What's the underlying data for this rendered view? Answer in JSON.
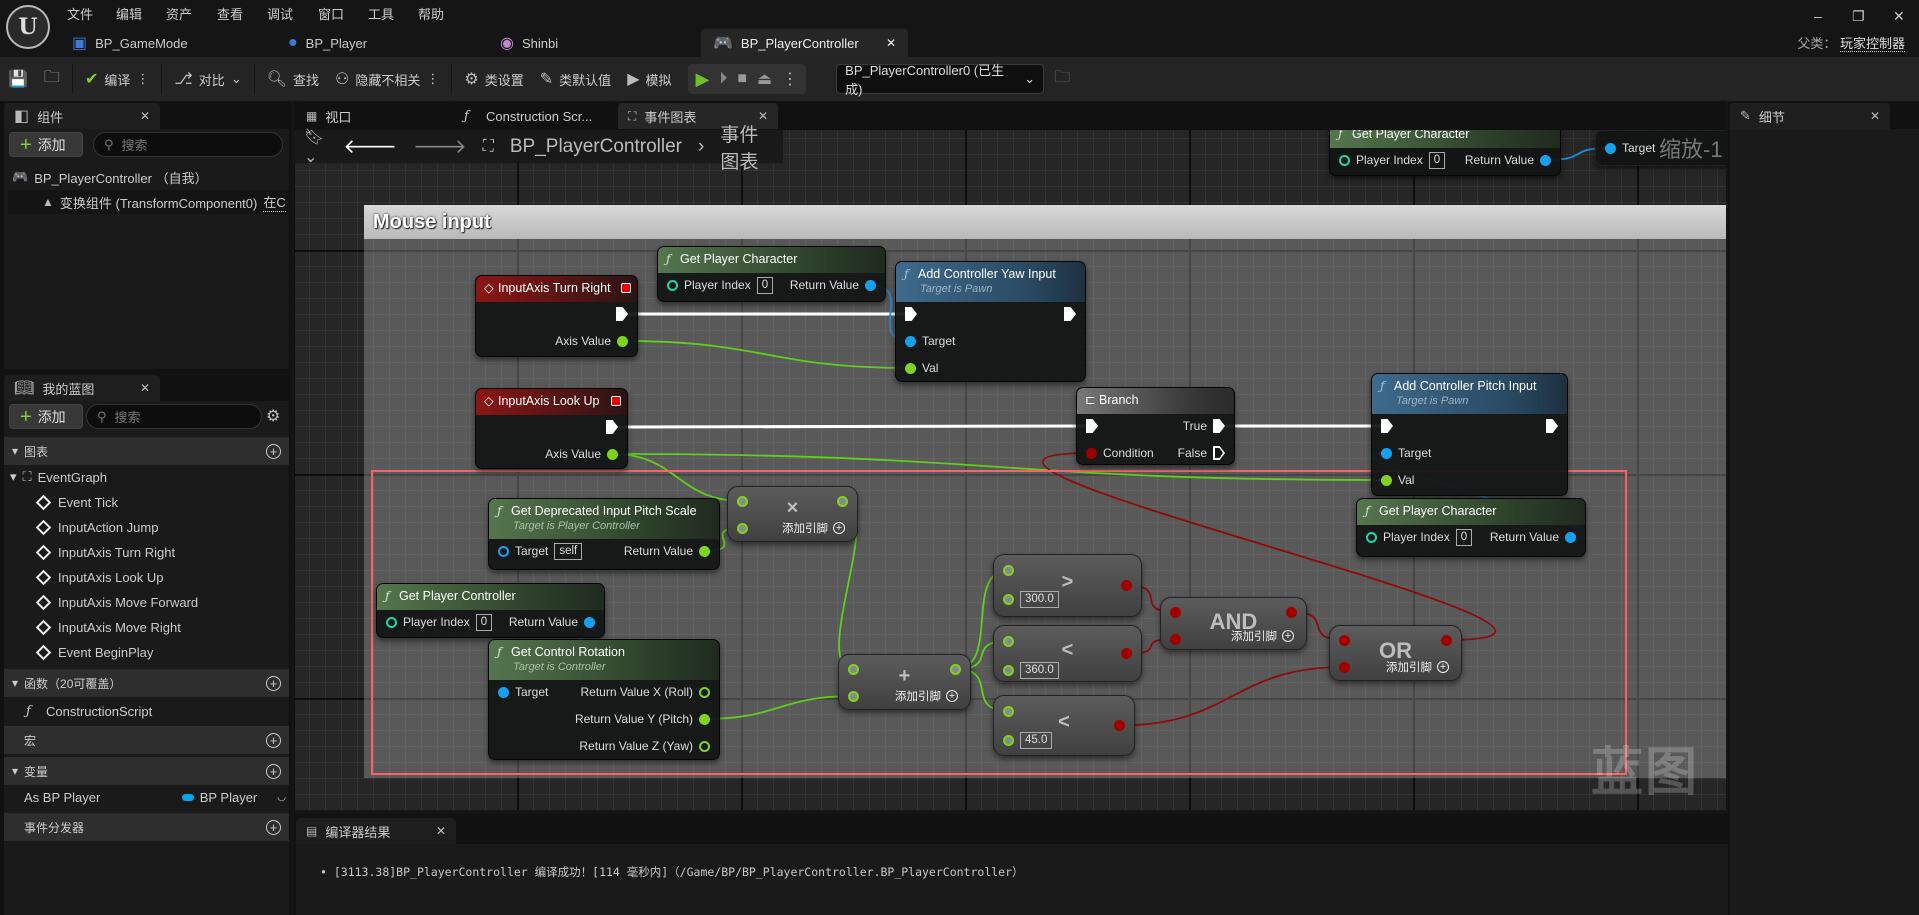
{
  "menu": [
    "文件",
    "编辑",
    "资产",
    "查看",
    "调试",
    "窗口",
    "工具",
    "帮助"
  ],
  "doc_tabs": [
    {
      "label": "BP_GameMode",
      "icon": "gamemode-icon"
    },
    {
      "label": "BP_Player",
      "icon": "pawn-icon"
    },
    {
      "label": "Shinbi",
      "icon": "skeleton-icon"
    },
    {
      "label": "BP_PlayerController",
      "icon": "gamepad-icon",
      "active": true
    }
  ],
  "parent_class": {
    "label": "父类：",
    "value": "玩家控制器"
  },
  "toolbar": {
    "compile": "编译",
    "diff": "对比",
    "find": "查找",
    "hide_unrelated": "隐藏不相关",
    "class_settings": "类设置",
    "class_defaults": "类默认值",
    "simulate": "模拟",
    "debug_object": "BP_PlayerController0 (已生成)"
  },
  "components": {
    "tab": "组件",
    "add": "添加",
    "search_placeholder": "搜索",
    "root": "BP_PlayerController （自我）",
    "child": "变换组件 (TransformComponent0)",
    "child_suffix": "在C"
  },
  "my_blueprint": {
    "tab": "我的蓝图",
    "add": "添加",
    "search_placeholder": "搜索",
    "graphs_header": "图表",
    "event_graph": "EventGraph",
    "events": [
      "Event Tick",
      "InputAction Jump",
      "InputAxis Turn Right",
      "InputAxis Look Up",
      "InputAxis Move Forward",
      "InputAxis Move Right",
      "Event BeginPlay"
    ],
    "functions_header": "函数（20可覆盖）",
    "functions": [
      "ConstructionScript"
    ],
    "macros_header": "宏",
    "variables_header": "变量",
    "variables": [
      {
        "name": "As BP Player",
        "type": "BP Player",
        "type_color": "#00a8f3"
      }
    ],
    "dispatchers_header": "事件分发器"
  },
  "graph_tabs": [
    {
      "label": "视口"
    },
    {
      "label": "Construction Scr..."
    },
    {
      "label": "事件图表",
      "active": true
    }
  ],
  "details": {
    "tab": "细节"
  },
  "breadcrumb": {
    "root": "BP_PlayerController",
    "current": "事件图表"
  },
  "graph": {
    "comment": "Mouse input",
    "zoom_label": "缩放-1",
    "watermark": "蓝图",
    "colors": {
      "exec": "#ffffff",
      "float": "#7ed321",
      "object": "#16a0f0",
      "bool": "#a00000",
      "int": "#1fd6a6",
      "selection": "#ff5f66"
    },
    "nodes": [
      {
        "id": "turn_right",
        "kind": "event",
        "title": "InputAxis Turn Right",
        "inputs": [],
        "outputs": [
          {
            "id": "exec",
            "type": "exec"
          },
          {
            "id": "axis",
            "label": "Axis Value",
            "type": "float"
          }
        ]
      },
      {
        "id": "gpc1",
        "kind": "pure",
        "title": "Get Player Character",
        "inputs": [
          {
            "id": "idx",
            "label": "Player Index",
            "type": "int",
            "default": "0"
          }
        ],
        "outputs": [
          {
            "id": "rv",
            "label": "Return Value",
            "type": "object"
          }
        ]
      },
      {
        "id": "yaw",
        "kind": "call",
        "title": "Add Controller Yaw Input",
        "subtitle": "Target is Pawn",
        "inputs": [
          {
            "id": "exec",
            "type": "exec"
          },
          {
            "id": "target",
            "label": "Target",
            "type": "object"
          },
          {
            "id": "val",
            "label": "Val",
            "type": "float"
          }
        ],
        "outputs": [
          {
            "id": "exec",
            "type": "exec"
          }
        ]
      },
      {
        "id": "look_up",
        "kind": "event",
        "title": "InputAxis Look Up",
        "inputs": [],
        "outputs": [
          {
            "id": "exec",
            "type": "exec"
          },
          {
            "id": "axis",
            "label": "Axis Value",
            "type": "float"
          }
        ]
      },
      {
        "id": "branch",
        "kind": "branch",
        "title": "Branch",
        "inputs": [
          {
            "id": "exec",
            "type": "exec"
          },
          {
            "id": "cond",
            "label": "Condition",
            "type": "bool"
          }
        ],
        "outputs": [
          {
            "id": "true",
            "label": "True",
            "type": "exec"
          },
          {
            "id": "false",
            "label": "False",
            "type": "exec"
          }
        ]
      },
      {
        "id": "pitch",
        "kind": "call",
        "title": "Add Controller Pitch Input",
        "subtitle": "Target is Pawn",
        "inputs": [
          {
            "id": "exec",
            "type": "exec"
          },
          {
            "id": "target",
            "label": "Target",
            "type": "object"
          },
          {
            "id": "val",
            "label": "Val",
            "type": "float"
          }
        ],
        "outputs": [
          {
            "id": "exec",
            "type": "exec"
          }
        ]
      },
      {
        "id": "gpc2",
        "kind": "pure",
        "title": "Get Player Character",
        "inputs": [
          {
            "id": "idx",
            "label": "Player Index",
            "type": "int",
            "default": "0"
          }
        ],
        "outputs": [
          {
            "id": "rv",
            "label": "Return Value",
            "type": "object"
          }
        ]
      },
      {
        "id": "pitch_scale",
        "kind": "pure",
        "title": "Get Deprecated Input Pitch Scale",
        "subtitle": "Target is Player Controller",
        "inputs": [
          {
            "id": "target",
            "label": "Target",
            "type": "object",
            "default": "self"
          }
        ],
        "outputs": [
          {
            "id": "rv",
            "label": "Return Value",
            "type": "float"
          }
        ]
      },
      {
        "id": "mul",
        "kind": "math",
        "symbol": "×",
        "add_pin": "添加引脚",
        "inputs": [
          {
            "id": "a",
            "type": "float"
          },
          {
            "id": "b",
            "type": "float"
          }
        ],
        "outputs": [
          {
            "id": "rv",
            "type": "float"
          }
        ]
      },
      {
        "id": "gpctrl",
        "kind": "pure",
        "title": "Get Player Controller",
        "inputs": [
          {
            "id": "idx",
            "label": "Player Index",
            "type": "int",
            "default": "0"
          }
        ],
        "outputs": [
          {
            "id": "rv",
            "label": "Return Value",
            "type": "object"
          }
        ]
      },
      {
        "id": "rot",
        "kind": "pure",
        "title": "Get Control Rotation",
        "subtitle": "Target is Controller",
        "inputs": [
          {
            "id": "target",
            "label": "Target",
            "type": "object"
          }
        ],
        "outputs": [
          {
            "id": "x",
            "label": "Return Value X (Roll)",
            "type": "float"
          },
          {
            "id": "y",
            "label": "Return Value Y (Pitch)",
            "type": "float"
          },
          {
            "id": "z",
            "label": "Return Value Z (Yaw)",
            "type": "float"
          }
        ]
      },
      {
        "id": "add",
        "kind": "math",
        "symbol": "+",
        "add_pin": "添加引脚",
        "inputs": [
          {
            "id": "a",
            "type": "float"
          },
          {
            "id": "b",
            "type": "float"
          }
        ],
        "outputs": [
          {
            "id": "rv",
            "type": "float"
          }
        ]
      },
      {
        "id": "gt",
        "kind": "compare",
        "symbol": ">",
        "inputs": [
          {
            "id": "a",
            "type": "float"
          },
          {
            "id": "b",
            "type": "float",
            "default": "300.0"
          }
        ],
        "outputs": [
          {
            "id": "rv",
            "type": "bool"
          }
        ]
      },
      {
        "id": "lt1",
        "kind": "compare",
        "symbol": "<",
        "inputs": [
          {
            "id": "a",
            "type": "float"
          },
          {
            "id": "b",
            "type": "float",
            "default": "360.0"
          }
        ],
        "outputs": [
          {
            "id": "rv",
            "type": "bool"
          }
        ]
      },
      {
        "id": "lt2",
        "kind": "compare",
        "symbol": "<",
        "inputs": [
          {
            "id": "a",
            "type": "float"
          },
          {
            "id": "b",
            "type": "float",
            "default": "45.0"
          }
        ],
        "outputs": [
          {
            "id": "rv",
            "type": "bool"
          }
        ]
      },
      {
        "id": "and",
        "kind": "math",
        "symbol": "AND",
        "add_pin": "添加引脚",
        "inputs": [
          {
            "id": "a",
            "type": "bool"
          },
          {
            "id": "b",
            "type": "bool"
          }
        ],
        "outputs": [
          {
            "id": "rv",
            "type": "bool"
          }
        ]
      },
      {
        "id": "or",
        "kind": "math",
        "symbol": "OR",
        "add_pin": "添加引脚",
        "inputs": [
          {
            "id": "a",
            "type": "bool"
          },
          {
            "id": "b",
            "type": "bool"
          }
        ],
        "outputs": [
          {
            "id": "rv",
            "type": "bool"
          }
        ]
      },
      {
        "id": "gpc_top",
        "kind": "pure",
        "title": "Get Player Character",
        "inputs": [
          {
            "id": "idx",
            "label": "Player Index",
            "type": "int",
            "default": "0"
          }
        ],
        "outputs": [
          {
            "id": "rv",
            "label": "Return Value",
            "type": "object"
          }
        ]
      },
      {
        "id": "target_partial",
        "kind": "partial",
        "inputs": [
          {
            "id": "target",
            "label": "Target",
            "type": "object"
          }
        ],
        "outputs": []
      }
    ],
    "links": [
      {
        "from": "turn_right.exec",
        "to": "yaw.exec",
        "type": "exec"
      },
      {
        "from": "look_up.exec",
        "to": "branch.exec",
        "type": "exec"
      },
      {
        "from": "branch.true",
        "to": "pitch.exec",
        "type": "exec"
      },
      {
        "from": "turn_right.axis",
        "to": "yaw.val",
        "type": "float"
      },
      {
        "from": "look_up.axis",
        "to": "pitch.val",
        "type": "float"
      },
      {
        "from": "look_up.axis",
        "to": "mul.a",
        "type": "float"
      },
      {
        "from": "pitch_scale.rv",
        "to": "mul.b",
        "type": "float"
      },
      {
        "from": "mul.rv",
        "to": "add.a",
        "type": "float"
      },
      {
        "from": "rot.y",
        "to": "add.b",
        "type": "float"
      },
      {
        "from": "add.rv",
        "to": "gt.a",
        "type": "float"
      },
      {
        "from": "add.rv",
        "to": "lt1.a",
        "type": "float"
      },
      {
        "from": "add.rv",
        "to": "lt2.a",
        "type": "float"
      },
      {
        "from": "gpc1.rv",
        "to": "yaw.target",
        "type": "object"
      },
      {
        "from": "gpc2.rv",
        "to": "pitch.target",
        "type": "object"
      },
      {
        "from": "gpctrl.rv",
        "to": "rot.target",
        "type": "object"
      },
      {
        "from": "gpc_top.rv",
        "to": "target_partial.target",
        "type": "object"
      },
      {
        "from": "gt.rv",
        "to": "and.a",
        "type": "bool"
      },
      {
        "from": "lt1.rv",
        "to": "and.b",
        "type": "bool"
      },
      {
        "from": "and.rv",
        "to": "or.a",
        "type": "bool"
      },
      {
        "from": "lt2.rv",
        "to": "or.b",
        "type": "bool"
      },
      {
        "from": "or.rv",
        "to": "branch.cond",
        "type": "bool"
      }
    ]
  },
  "compiler": {
    "tab": "编译器结果",
    "message": "[3113.38]BP_PlayerController 编译成功！[114 毫秒内]（/Game/BP/BP_PlayerController.BP_PlayerController）"
  }
}
